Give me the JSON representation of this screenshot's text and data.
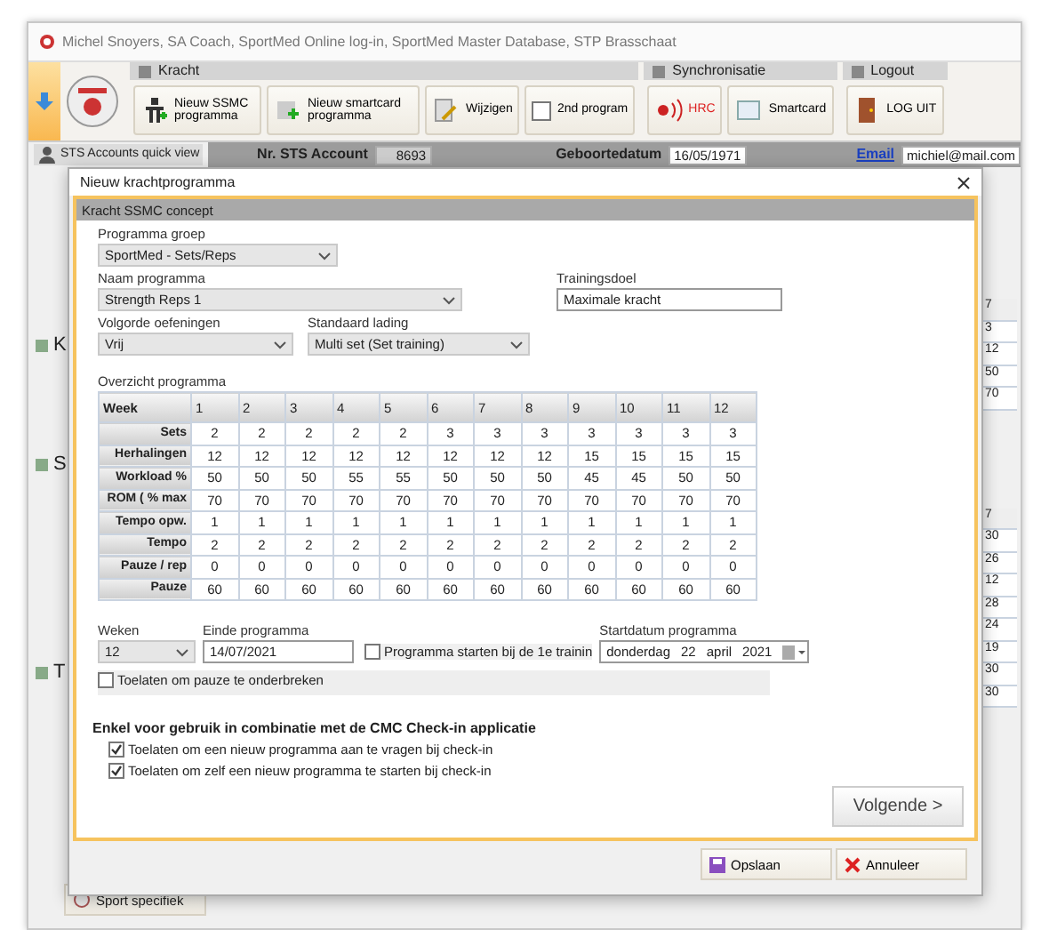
{
  "window": {
    "title": "Michel Snoyers, SA Coach, SportMed Online log-in, SportMed Master Database, STP Brasschaat"
  },
  "ribbon": {
    "groups": [
      {
        "title": "Kracht",
        "buttons": [
          {
            "label": "Nieuw SSMC programma",
            "kind": "button"
          },
          {
            "label": "Nieuw smartcard programma",
            "kind": "button"
          },
          {
            "label": "Wijzigen",
            "kind": "button"
          },
          {
            "label": "2nd program",
            "kind": "checkbox",
            "checked": false
          }
        ]
      },
      {
        "title": "Synchronisatie",
        "buttons": [
          {
            "label": "HRC",
            "kind": "alert"
          },
          {
            "label": "Smartcard",
            "kind": "button"
          }
        ]
      },
      {
        "title": "Logout",
        "buttons": [
          {
            "label": "LOG UIT",
            "kind": "button"
          }
        ]
      }
    ]
  },
  "sidebar": {
    "title": "STS Accounts quick view",
    "groups": [
      "K",
      "S",
      "T"
    ],
    "footer_item": "Sport specifiek"
  },
  "account_bar": {
    "fields": [
      {
        "label": "Nr. STS Account",
        "value": "8693",
        "kind": "text"
      },
      {
        "label": "Geboortedatum",
        "value": "16/05/1971",
        "kind": "text"
      },
      {
        "label": "Email",
        "value": "michiel@mail.com",
        "kind": "link"
      }
    ]
  },
  "background_tables": [
    {
      "header": "7",
      "values": [
        "3",
        "12",
        "50",
        "70"
      ]
    },
    {
      "header": "7",
      "values": [
        "30",
        "26",
        "12",
        "28",
        "24",
        "19",
        "30",
        "30"
      ]
    }
  ],
  "dialog": {
    "title": "Nieuw krachtprogramma",
    "section_title": "Kracht SSMC concept",
    "programma_groep": {
      "label": "Programma groep",
      "value": "SportMed - Sets/Reps"
    },
    "naam_programma": {
      "label": "Naam programma",
      "value": "Strength Reps 1"
    },
    "trainingsdoel": {
      "label": "Trainingsdoel",
      "value": "Maximale kracht"
    },
    "volgorde": {
      "label": "Volgorde oefeningen",
      "value": "Vrij"
    },
    "standaard_lading": {
      "label": "Standaard lading",
      "value": "Multi set (Set training)"
    },
    "overview_label": "Overzicht programma",
    "table": {
      "columns": [
        "Week",
        "1",
        "2",
        "3",
        "4",
        "5",
        "6",
        "7",
        "8",
        "9",
        "10",
        "11",
        "12"
      ],
      "rows": [
        {
          "label": "Sets",
          "values": [
            "2",
            "2",
            "2",
            "2",
            "2",
            "3",
            "3",
            "3",
            "3",
            "3",
            "3",
            "3"
          ]
        },
        {
          "label": "Herhalingen",
          "values": [
            "12",
            "12",
            "12",
            "12",
            "12",
            "12",
            "12",
            "12",
            "15",
            "15",
            "15",
            "15"
          ]
        },
        {
          "label": "Workload %",
          "values": [
            "50",
            "50",
            "50",
            "55",
            "55",
            "50",
            "50",
            "50",
            "45",
            "45",
            "50",
            "50"
          ]
        },
        {
          "label": "ROM ( % max",
          "values": [
            "70",
            "70",
            "70",
            "70",
            "70",
            "70",
            "70",
            "70",
            "70",
            "70",
            "70",
            "70"
          ]
        },
        {
          "label": "Tempo opw.",
          "values": [
            "1",
            "1",
            "1",
            "1",
            "1",
            "1",
            "1",
            "1",
            "1",
            "1",
            "1",
            "1"
          ]
        },
        {
          "label": "Tempo",
          "values": [
            "2",
            "2",
            "2",
            "2",
            "2",
            "2",
            "2",
            "2",
            "2",
            "2",
            "2",
            "2"
          ]
        },
        {
          "label": "Pauze / rep",
          "values": [
            "0",
            "0",
            "0",
            "0",
            "0",
            "0",
            "0",
            "0",
            "0",
            "0",
            "0",
            "0"
          ]
        },
        {
          "label": "Pauze",
          "values": [
            "60",
            "60",
            "60",
            "60",
            "60",
            "60",
            "60",
            "60",
            "60",
            "60",
            "60",
            "60"
          ]
        }
      ]
    },
    "weken": {
      "label": "Weken",
      "value": "12"
    },
    "einde": {
      "label": "Einde programma",
      "value": "14/07/2021"
    },
    "start_first_training": {
      "label": "Programma starten bij de 1e trainin",
      "checked": false
    },
    "startdatum": {
      "label": "Startdatum programma",
      "weekday": "donderdag",
      "day": "22",
      "month": "april",
      "year": "2021"
    },
    "allow_pause": {
      "label": "Toelaten om pauze te onderbreken",
      "checked": false
    },
    "cmc_heading": "Enkel voor gebruik in combinatie met de CMC Check-in applicatie",
    "cmc_options": [
      {
        "label": "Toelaten om een nieuw programma aan te vragen bij check-in",
        "checked": true
      },
      {
        "label": "Toelaten om zelf een nieuw programma te starten bij check-in",
        "checked": true
      }
    ],
    "next_button": "Volgende >",
    "footer_buttons": [
      {
        "label": "Opslaan",
        "kind": "save"
      },
      {
        "label": "Annuleer",
        "kind": "cancel"
      }
    ]
  }
}
